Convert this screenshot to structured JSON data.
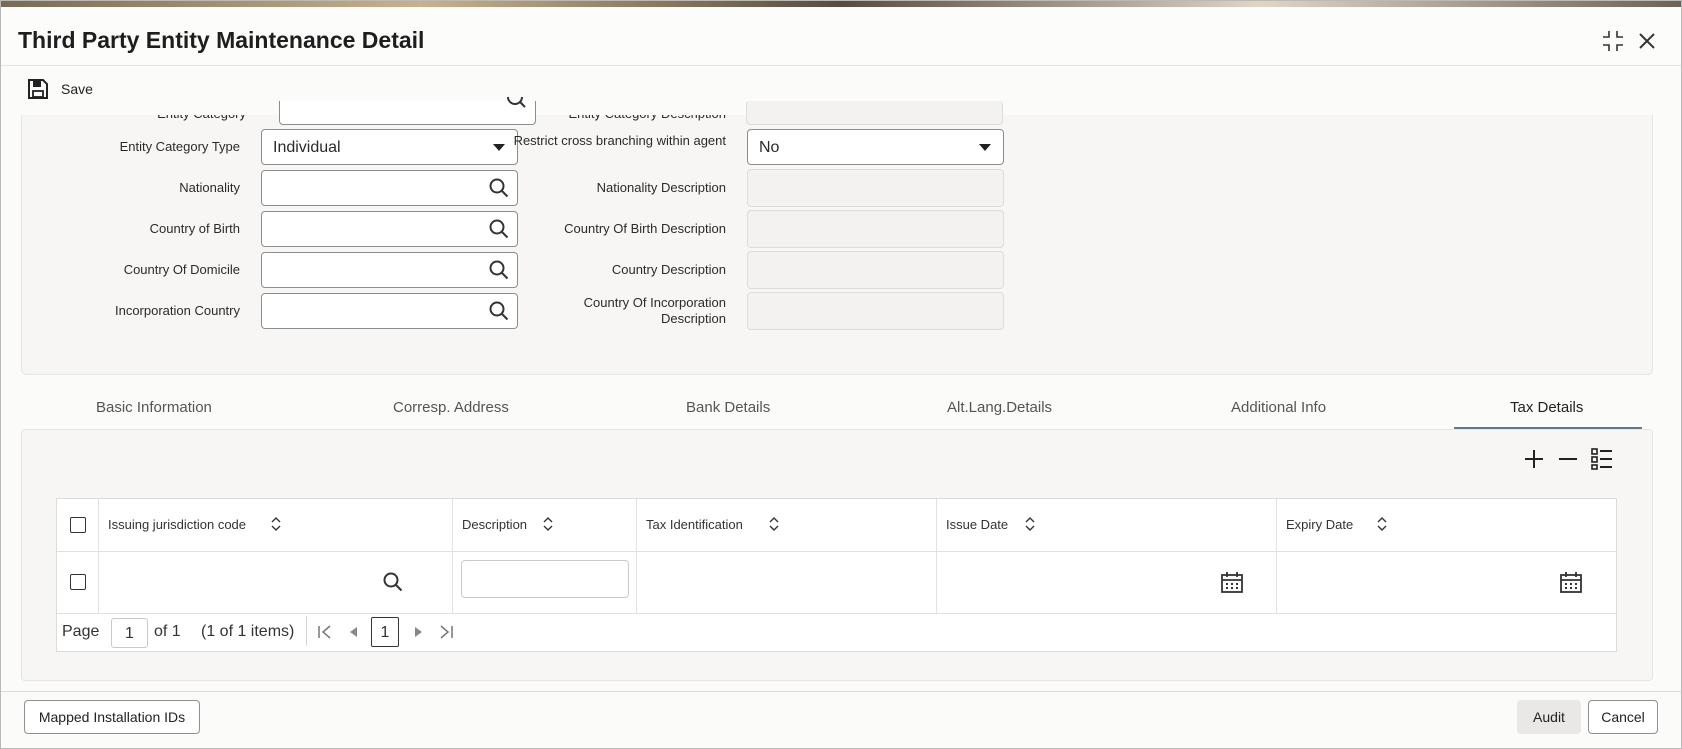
{
  "window": {
    "title": "Third Party Entity Maintenance Detail"
  },
  "toolbar": {
    "save_label": "Save"
  },
  "form": {
    "entity_category_label": "Entity Category",
    "entity_category_desc_label": "Entity Category Description",
    "entity_category_type_label": "Entity Category Type",
    "entity_category_type_value": "Individual",
    "restrict_cross_branching_label": "Restrict cross branching within agent",
    "restrict_cross_branching_value": "No",
    "nationality_label": "Nationality",
    "nationality_desc_label": "Nationality Description",
    "country_of_birth_label": "Country of Birth",
    "country_of_birth_desc_label": "Country Of Birth Description",
    "country_of_domicile_label": "Country Of Domicile",
    "country_desc_label": "Country Description",
    "incorporation_country_label": "Incorporation Country",
    "incorporation_desc_label": "Country Of Incorporation Description"
  },
  "tabs": [
    {
      "label": "Basic Information"
    },
    {
      "label": "Corresp. Address"
    },
    {
      "label": "Bank Details"
    },
    {
      "label": "Alt.Lang.Details"
    },
    {
      "label": "Additional Info"
    },
    {
      "label": "Tax Details",
      "active": true
    }
  ],
  "grid": {
    "columns": [
      "Issuing jurisdiction code",
      "Description",
      "Tax Identification",
      "Issue Date",
      "Expiry Date"
    ],
    "rows": [
      {
        "issuing_jurisdiction_code": "",
        "description": "",
        "tax_identification": "",
        "issue_date": "",
        "expiry_date": ""
      }
    ],
    "pager": {
      "page_label": "Page",
      "page_value": "1",
      "of_label": "of 1",
      "items_label": "(1 of 1 items)",
      "current_page": "1"
    }
  },
  "footer": {
    "mapped_ids_label": "Mapped Installation IDs",
    "audit_label": "Audit",
    "cancel_label": "Cancel"
  },
  "colors": {
    "accent": "#5d7a90",
    "panel": "#f7f6f4"
  },
  "icons": [
    "save-icon",
    "maximize-icon",
    "close-icon",
    "search-icon",
    "dropdown-arrow-icon",
    "add-row-icon",
    "delete-row-icon",
    "single-view-icon",
    "sort-icon",
    "calendar-icon",
    "first-page-icon",
    "prev-page-icon",
    "next-page-icon",
    "last-page-icon"
  ]
}
